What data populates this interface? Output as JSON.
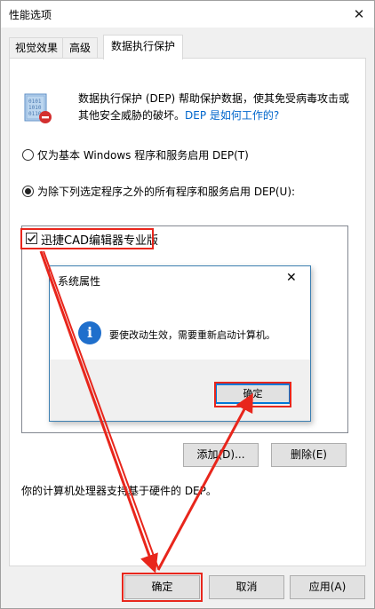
{
  "window": {
    "title": "性能选项",
    "close_glyph": "✕"
  },
  "tabs": [
    {
      "label": "视觉效果"
    },
    {
      "label": "高级"
    },
    {
      "label": "数据执行保护"
    }
  ],
  "dep": {
    "description": "数据执行保护 (DEP) 帮助保护数据，使其免受病毒攻击或其他安全威胁的破坏。",
    "link": "DEP 是如何工作的?"
  },
  "options": {
    "essential": "仅为基本 Windows 程序和服务启用 DEP(T)",
    "all_except": "为除下列选定程序之外的所有程序和服务启用 DEP(U):",
    "selected": "all_except"
  },
  "program_list": [
    {
      "label": "迅捷CAD编辑器专业版",
      "checked": true
    }
  ],
  "buttons": {
    "add": "添加(D)...",
    "remove": "删除(E)"
  },
  "status_text": "你的计算机处理器支持基于硬件的 DEP。",
  "footer": {
    "ok": "确定",
    "cancel": "取消",
    "apply": "应用(A)"
  },
  "dialog": {
    "title": "系统属性",
    "close_glyph": "✕",
    "icon_glyph": "i",
    "message": "要使改动生效，需要重新启动计算机。",
    "ok": "确定"
  },
  "colors": {
    "annotation": "#e8261c",
    "link": "#0066cc",
    "dialog_accent": "#0078d7"
  }
}
